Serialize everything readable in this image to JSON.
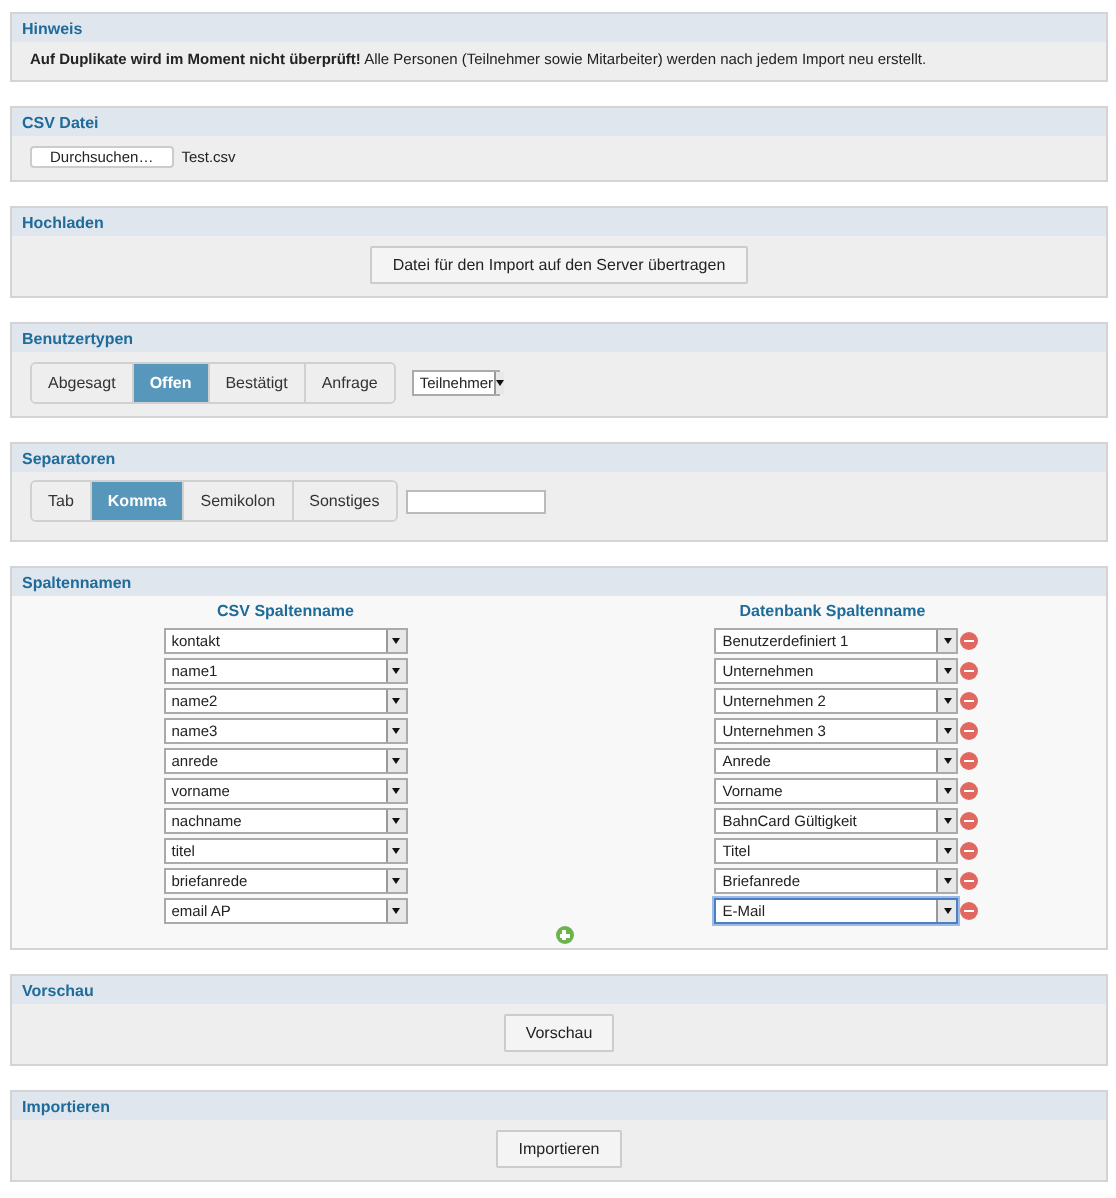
{
  "hinweis": {
    "title": "Hinweis",
    "text": "**Auf Duplikate wird im Moment nicht überprüft!** Alle Personen (Teilnehmer sowie Mitarbeiter) werden nach jedem Import neu erstellt."
  },
  "csv_datei": {
    "title": "CSV Datei",
    "button": "Durchsuchen…",
    "filename": "Test.csv"
  },
  "hochladen": {
    "title": "Hochladen",
    "button": "Datei für den Import auf den Server übertragen"
  },
  "benutzertypen": {
    "title": "Benutzertypen",
    "segments": [
      {
        "label": "Abgesagt",
        "selected": false
      },
      {
        "label": "Offen",
        "selected": true
      },
      {
        "label": "Bestätigt",
        "selected": false
      },
      {
        "label": "Anfrage",
        "selected": false
      }
    ],
    "dropdown": "Teilnehmer"
  },
  "separatoren": {
    "title": "Separatoren",
    "segments": [
      {
        "label": "Tab",
        "selected": false
      },
      {
        "label": "Komma",
        "selected": true
      },
      {
        "label": "Semikolon",
        "selected": false
      },
      {
        "label": "Sonstiges",
        "selected": false
      }
    ]
  },
  "spaltennamen": {
    "title": "Spaltennamen",
    "csv_heading": "CSV Spaltenname",
    "db_heading": "Datenbank Spaltenname",
    "rows": [
      {
        "csv": "kontakt",
        "db": "Benutzerdefiniert 1",
        "db_focused": false
      },
      {
        "csv": "name1",
        "db": "Unternehmen",
        "db_focused": false
      },
      {
        "csv": "name2",
        "db": "Unternehmen 2",
        "db_focused": false
      },
      {
        "csv": "name3",
        "db": "Unternehmen 3",
        "db_focused": false
      },
      {
        "csv": "anrede",
        "db": "Anrede",
        "db_focused": false
      },
      {
        "csv": "vorname",
        "db": "Vorname",
        "db_focused": false
      },
      {
        "csv": "nachname",
        "db": "BahnCard Gültigkeit",
        "db_focused": false
      },
      {
        "csv": "titel",
        "db": "Titel",
        "db_focused": false
      },
      {
        "csv": "briefanrede",
        "db": "Briefanrede",
        "db_focused": false
      },
      {
        "csv": "email AP",
        "db": "E-Mail",
        "db_focused": true
      }
    ]
  },
  "vorschau": {
    "title": "Vorschau",
    "button": "Vorschau"
  },
  "importieren": {
    "title": "Importieren",
    "button": "Importieren"
  }
}
